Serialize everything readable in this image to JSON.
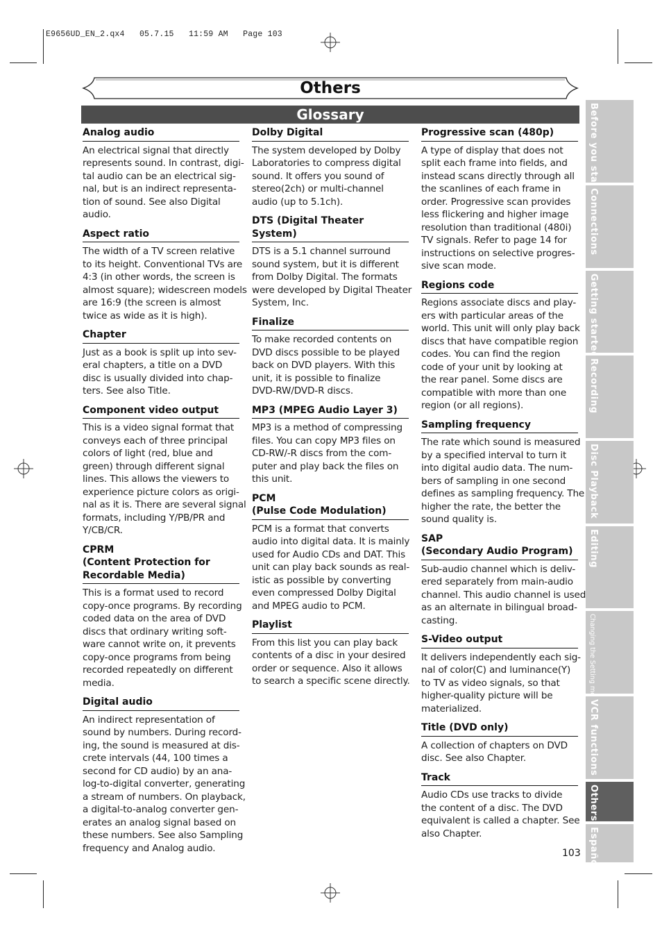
{
  "print_slug": {
    "filename": "E9656UD_EN_2.qx4",
    "date": "05.7.15",
    "time": "11:59 AM",
    "page_label": "Page 103"
  },
  "section_title": "Others",
  "subsection_title": "Glossary",
  "columns": [
    {
      "entries": [
        {
          "term": [
            "Analog audio"
          ],
          "definition": [
            "An electrical signal that directly",
            "represents sound. In contrast, digi-",
            "tal audio can be an electrical sig-",
            "nal, but is an indirect representa-",
            "tion of sound. See also Digital",
            "audio."
          ]
        },
        {
          "term": [
            "Aspect ratio"
          ],
          "definition": [
            "The width of a TV screen relative",
            "to its height. Conventional TVs are",
            "4:3 (in other words, the screen is",
            "almost square); widescreen models",
            "are 16:9 (the screen is almost",
            "twice as wide as it is high)."
          ]
        },
        {
          "term": [
            "Chapter"
          ],
          "definition": [
            "Just as a book is split up into sev-",
            "eral chapters, a title on a DVD",
            "disc is usually divided into chap-",
            "ters. See also Title."
          ]
        },
        {
          "term": [
            "Component video output"
          ],
          "definition": [
            "This is a video signal format that",
            "conveys each of three principal",
            "colors of light (red, blue and",
            "green) through different signal",
            "lines. This allows the viewers to",
            "experience picture colors as origi-",
            "nal as it is. There are several signal",
            "formats, including Y/PB/PR and",
            "Y/CB/CR."
          ]
        },
        {
          "term": [
            "CPRM",
            "(Content Protection for",
            "Recordable Media)"
          ],
          "definition": [
            "This is a format used to record",
            "copy-once programs. By recording",
            "coded data on the area of DVD",
            "discs that ordinary writing soft-",
            "ware cannot write on, it prevents",
            "copy-once programs from being",
            "recorded repeatedly on different",
            "media."
          ]
        },
        {
          "term": [
            "Digital audio"
          ],
          "definition": [
            "An indirect representation of",
            "sound by numbers. During record-",
            "ing, the sound is measured at dis-",
            "crete intervals (44, 100 times a",
            "second for CD audio) by an ana-",
            "log-to-digital converter, generating",
            "a stream of numbers. On playback,",
            "a digital-to-analog converter gen-",
            "erates an analog signal based on",
            "these numbers. See also Sampling",
            "frequency and Analog audio."
          ]
        }
      ]
    },
    {
      "entries": [
        {
          "term": [
            "Dolby Digital"
          ],
          "definition": [
            "The system developed by Dolby",
            "Laboratories to compress digital",
            "sound. It offers you sound of",
            "stereo(2ch) or multi-channel",
            "audio (up to 5.1ch)."
          ]
        },
        {
          "term": [
            "DTS (Digital Theater System)"
          ],
          "definition": [
            "DTS is a 5.1 channel surround",
            "sound system, but it is different",
            "from Dolby Digital. The formats",
            "were developed by Digital Theater",
            "System, Inc."
          ]
        },
        {
          "term": [
            "Finalize"
          ],
          "definition": [
            "To make recorded contents on",
            "DVD discs possible to be played",
            "back on DVD players. With this",
            "unit, it is possible to finalize",
            "DVD-RW/DVD-R discs."
          ]
        },
        {
          "term": [
            "MP3 (MPEG Audio Layer 3)"
          ],
          "definition": [
            "MP3 is a method of compressing",
            "files. You can copy MP3 files on",
            "CD-RW/-R discs from the com-",
            "puter and play back the files on",
            "this unit."
          ]
        },
        {
          "term": [
            "PCM",
            "(Pulse Code Modulation)"
          ],
          "definition": [
            "PCM is a format that converts",
            "audio into digital data. It is mainly",
            "used for Audio CDs and DAT. This",
            "unit can play back sounds as real-",
            "istic as possible by converting",
            "even compressed Dolby Digital",
            "and MPEG audio to PCM."
          ]
        },
        {
          "term": [
            "Playlist"
          ],
          "definition": [
            "From this list you can play back",
            "contents of a disc in your desired",
            "order or sequence. Also it allows",
            "to search a specific scene directly."
          ]
        }
      ]
    },
    {
      "entries": [
        {
          "term": [
            "Progressive scan (480p)"
          ],
          "definition": [
            "A type of display that does not",
            "split each frame into fields, and",
            "instead scans directly through all",
            "the scanlines of each frame in",
            "order. Progressive scan provides",
            "less flickering and higher image",
            "resolution than traditional (480i)",
            "TV signals. Refer to page 14 for",
            "instructions on selective progres-",
            "sive scan mode."
          ]
        },
        {
          "term": [
            "Regions code"
          ],
          "definition": [
            "Regions associate discs and play-",
            "ers with particular areas of the",
            "world. This unit will only play back",
            "discs that have compatible region",
            "codes. You can find the region",
            "code of your unit by looking at",
            "the rear panel. Some discs are",
            "compatible with more than one",
            "region (or all regions)."
          ]
        },
        {
          "term": [
            "Sampling frequency"
          ],
          "definition": [
            "The rate which sound is measured",
            "by a specified interval to turn it",
            "into digital audio data. The num-",
            "bers of sampling in one second",
            "defines as sampling frequency. The",
            "higher the rate, the better the",
            "sound quality is."
          ]
        },
        {
          "term": [
            "SAP",
            "(Secondary Audio Program)"
          ],
          "definition": [
            "Sub-audio channel which is deliv-",
            "ered separately from main-audio",
            "channel. This audio channel is used",
            "as an alternate in bilingual broad-",
            "casting."
          ]
        },
        {
          "term": [
            "S-Video output"
          ],
          "definition": [
            "It delivers independently each sig-",
            "nal of color(C) and luminance(Y)",
            "to TV as video signals, so that",
            "higher-quality picture will be",
            "materialized."
          ]
        },
        {
          "term": [
            "Title (DVD only)"
          ],
          "definition": [
            "A collection of chapters on DVD",
            "disc. See also Chapter."
          ]
        },
        {
          "term": [
            "Track"
          ],
          "definition": [
            "Audio CDs use tracks to divide",
            "the content of a disc. The DVD",
            "equivalent is called a chapter. See",
            "also Chapter."
          ]
        }
      ]
    }
  ],
  "side_tabs": [
    {
      "label": "Before you start",
      "active": false
    },
    {
      "label": "Connections",
      "active": false
    },
    {
      "label": "Getting started",
      "active": false
    },
    {
      "label": "Recording",
      "active": false
    },
    {
      "label": "Disc Playback",
      "active": false
    },
    {
      "label": "Editing",
      "active": false
    },
    {
      "label": "Changing the Setting menu",
      "active": false
    },
    {
      "label": "VCR functions",
      "active": false
    },
    {
      "label": "Others",
      "active": true
    },
    {
      "label": "Español",
      "active": false
    }
  ],
  "page_number": "103",
  "colors": {
    "glossary_bar": "#4d4d4d",
    "tab_inactive": "#c8c8c8",
    "tab_active": "#5f5f5f"
  }
}
